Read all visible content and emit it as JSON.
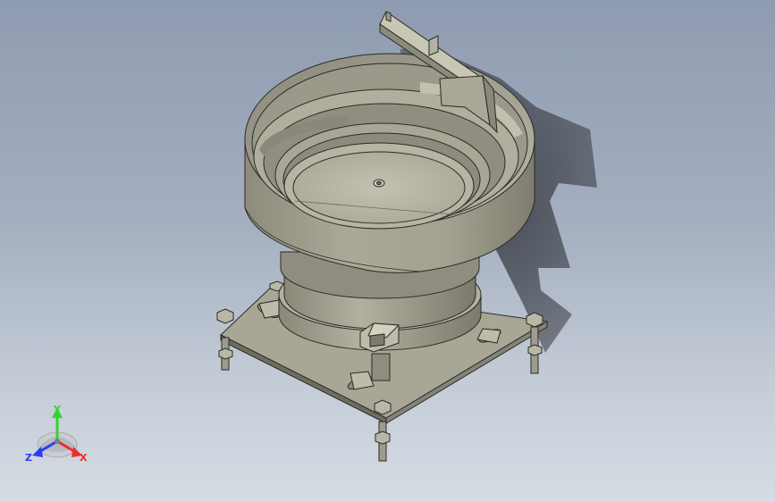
{
  "viewport": {
    "model": "vibratory-bowl-feeder",
    "view_style": "shaded-with-edges",
    "background": [
      "#8f9bb0",
      "#d6dce4"
    ],
    "part_color": "#a9a796",
    "shadow_color": "#4a4e56"
  },
  "triad": {
    "x_label": "X",
    "y_label": "Y",
    "z_label": "Z",
    "x_color": "#e8312a",
    "y_color": "#2fd62f",
    "z_color": "#2a3fe8"
  }
}
